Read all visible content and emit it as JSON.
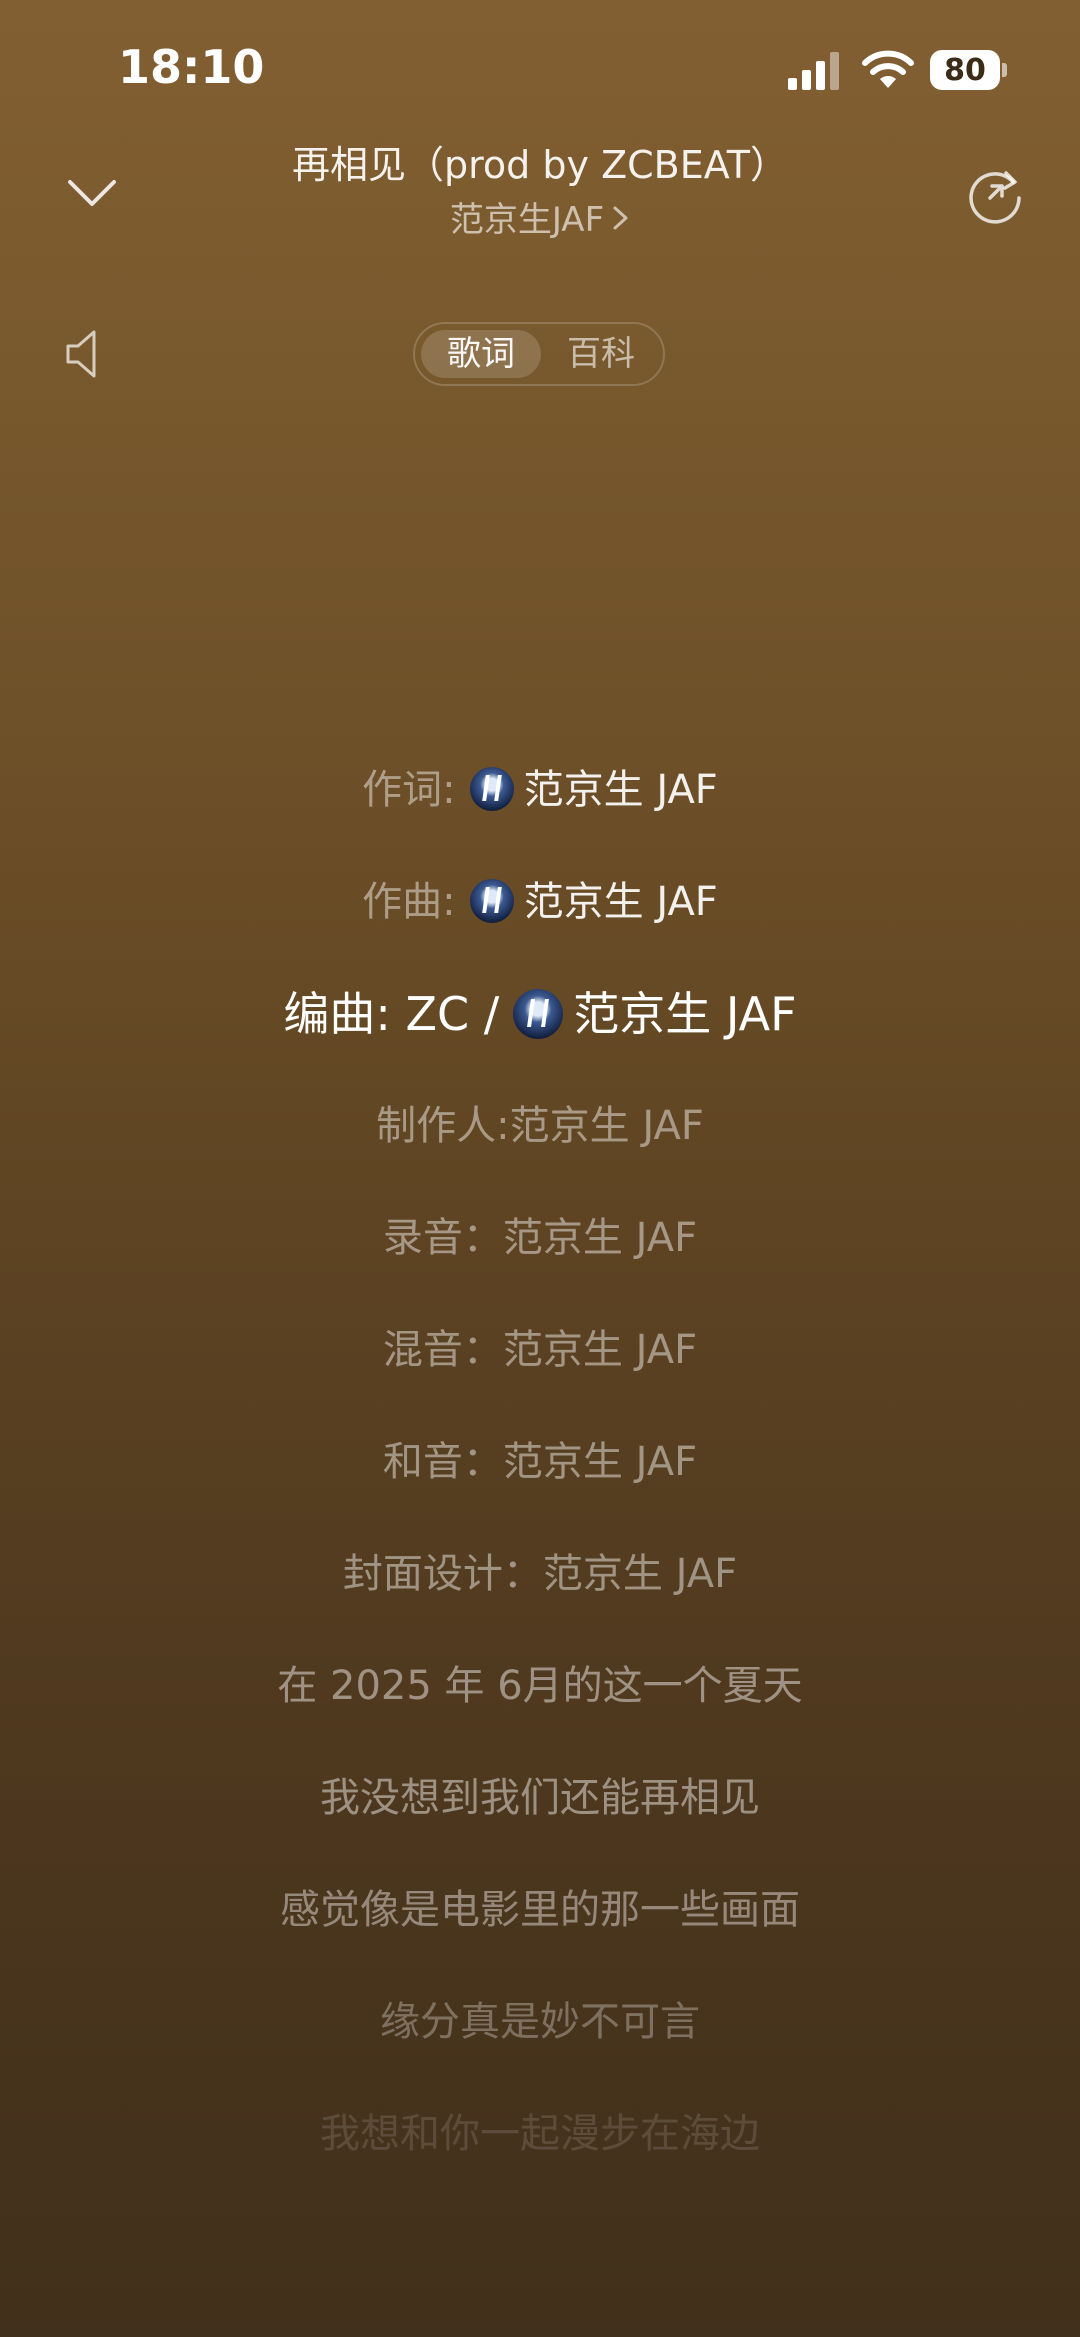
{
  "status_bar": {
    "time": "18:10",
    "battery": "80"
  },
  "header": {
    "song_title": "再相见（prod by ZCBEAT）",
    "artist": "范京生JAF"
  },
  "mode_tabs": {
    "lyrics": "歌词",
    "wiki": "百科",
    "selected": "歌词"
  },
  "lyrics": [
    {
      "label": "作词:",
      "name": "范京生 JAF"
    },
    {
      "label": "作曲:",
      "name": "范京生 JAF"
    },
    {
      "label": "编曲:  ZC /",
      "name": "范京生 JAF"
    },
    {
      "text": "制作人:范京生 JAF"
    },
    {
      "text": "录音：范京生 JAF"
    },
    {
      "text": "混音：范京生 JAF"
    },
    {
      "text": "和音：范京生 JAF"
    },
    {
      "text": "封面设计：范京生 JAF"
    },
    {
      "text": "在 2025 年 6月的这一个夏天"
    },
    {
      "text": "我没想到我们还能再相见"
    },
    {
      "text": "感觉像是电影里的那一些画面"
    },
    {
      "text": "缘分真是妙不可言"
    },
    {
      "text": "我想和你一起漫步在海边"
    }
  ],
  "colors": {
    "background_top": "#825f32",
    "background_bottom": "#41301b"
  }
}
